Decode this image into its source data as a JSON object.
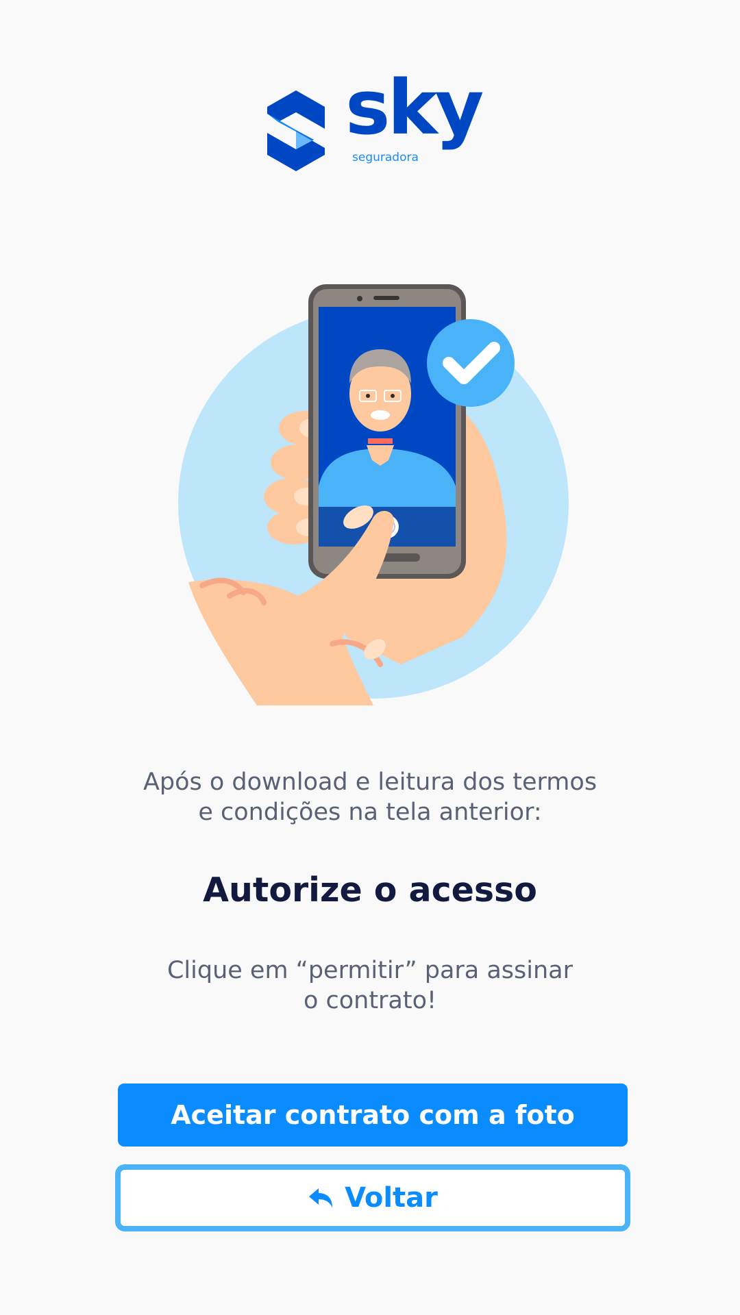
{
  "brand": {
    "name": "sky",
    "subtitle": "seguradora",
    "primary_color": "#0047c4",
    "accent_color": "#1a8cff"
  },
  "illustration": {
    "icon": "phone-selfie-check-illustration"
  },
  "intro": {
    "line1": "Após o download e leitura dos termos",
    "line2": "e condições na tela anterior:"
  },
  "heading": "Autorize o acesso",
  "instruction": {
    "line1": "Clique em “permitir” para assinar",
    "line2": "o contrato!"
  },
  "buttons": {
    "accept_label": "Aceitar contrato com a foto",
    "back_label": "Voltar",
    "back_icon": "reply-arrow-icon"
  },
  "colors": {
    "button_primary": "#0a8cff",
    "button_border": "#4ab3f8",
    "heading_text": "#121a3f",
    "body_text": "#5a6175",
    "background": "#f9f9fa"
  }
}
